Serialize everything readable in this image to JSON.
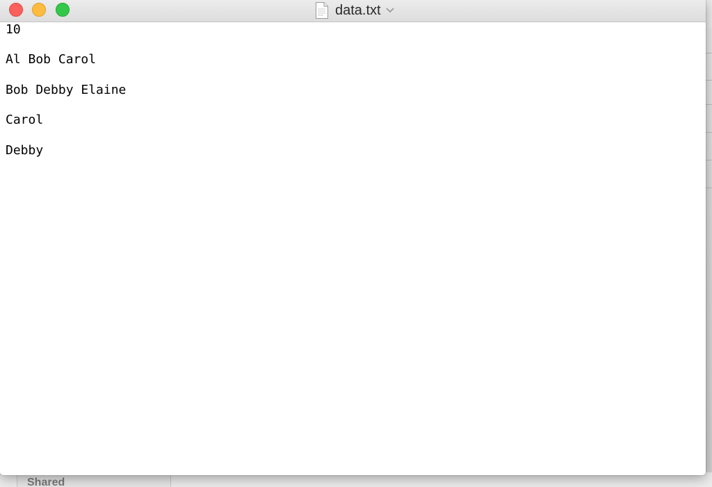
{
  "window": {
    "title": "data.txt",
    "file_icon": "document-icon",
    "title_menu_icon": "chevron-down-icon"
  },
  "traffic_lights": {
    "close_color": "#fc605c",
    "minimize_color": "#fdbc40",
    "zoom_color": "#34c84a"
  },
  "editor": {
    "lines": [
      "10",
      "Al Bob Carol",
      "Bob Debby Elaine",
      "Carol",
      "Debby"
    ]
  },
  "background": {
    "sidebar_label": "Shared"
  }
}
